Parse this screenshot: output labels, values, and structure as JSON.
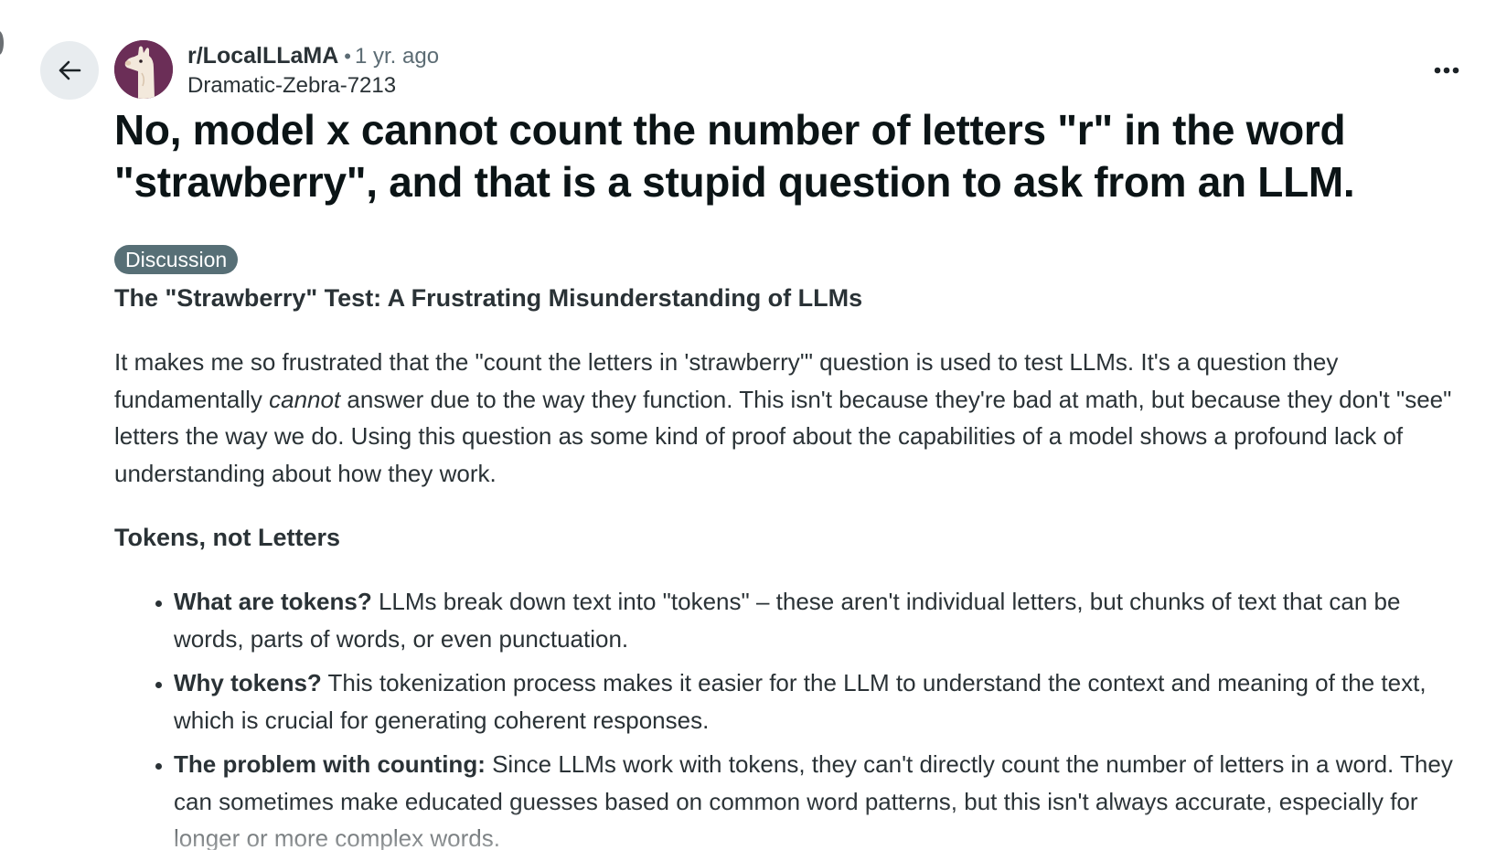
{
  "post": {
    "subreddit": "r/LocalLLaMA",
    "separator": "•",
    "time_ago": "1 yr. ago",
    "author": "Dramatic-Zebra-7213",
    "title": "No, model x cannot count the number of letters \"r\" in the word \"strawberry\", and that is a stupid question to ask from an LLM.",
    "flair": "Discussion",
    "subheading": "The \"Strawberry\" Test: A Frustrating Misunderstanding of LLMs",
    "intro": {
      "part1": "It makes me so frustrated that the \"count the letters in 'strawberry'\" question is used to test LLMs. It's a question they fundamentally ",
      "emphasis": "cannot",
      "part2": " answer due to the way they function. This isn't because they're bad at math, but because they don't \"see\" letters the way we do. Using this question as some kind of proof about the capabilities of a model shows a profound lack of understanding about how they work."
    },
    "section_heading": "Tokens, not Letters",
    "bullets": [
      {
        "bold": "What are tokens?",
        "text": " LLMs break down text into \"tokens\" – these aren't individual letters, but chunks of text that can be words, parts of words, or even punctuation."
      },
      {
        "bold": "Why tokens?",
        "text": " This tokenization process makes it easier for the LLM to understand the context and meaning of the text, which is crucial for generating coherent responses."
      },
      {
        "bold": "The problem with counting:",
        "text": " Since LLMs work with tokens, they can't directly count the number of letters in a word. They can sometimes make educated guesses based on common word patterns, but this isn't always accurate, especially for longer or more complex words."
      }
    ]
  },
  "icons": {
    "back": "arrow-left-icon",
    "more": "more-options-icon",
    "avatar": "llama-avatar"
  },
  "colors": {
    "avatar_bg": "#6b2e57",
    "flair_bg": "#576f76",
    "back_button_bg": "#e8ecef",
    "title_text": "#0b1416",
    "body_text": "#2a3236",
    "muted_text": "#5c6c74"
  }
}
